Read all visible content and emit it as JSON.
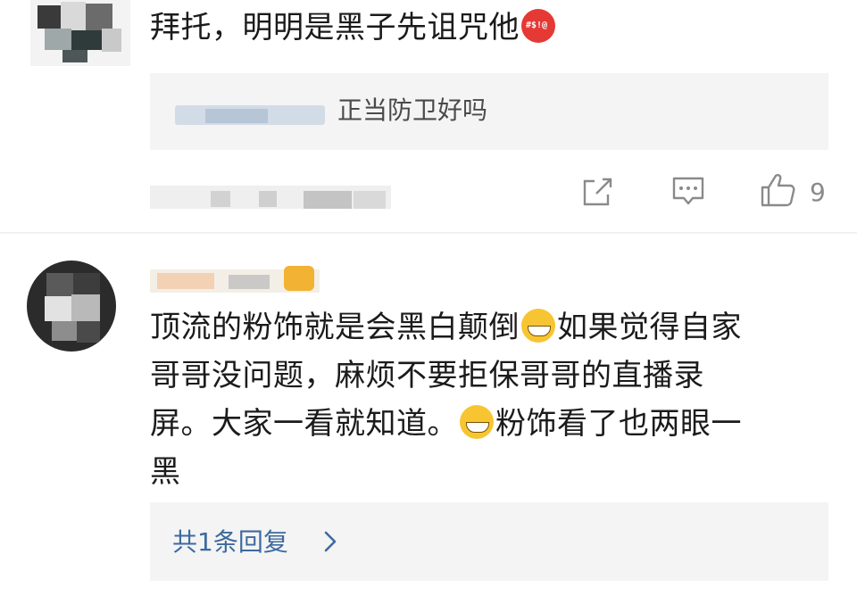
{
  "comment_1": {
    "text": "拜托，明明是黑子先诅咒他",
    "emoji": "angry-face-icon",
    "quote": {
      "text": "正当防卫好吗"
    },
    "actions": {
      "share_icon": "share-icon",
      "comment_icon": "comment-icon",
      "like_icon": "thumbs-up-icon",
      "like_count": "9"
    }
  },
  "comment_2": {
    "lines": [
      "顶流的粉饰就是会黑白颠倒",
      "如果觉得自家",
      "哥哥没问题，麻烦不要拒保哥哥的直播录",
      "屏。大家一看就知道。",
      "粉饰看了也两眼一",
      "黑"
    ],
    "emoji": "grinning-face-icon",
    "reply_summary": "共1条回复"
  }
}
